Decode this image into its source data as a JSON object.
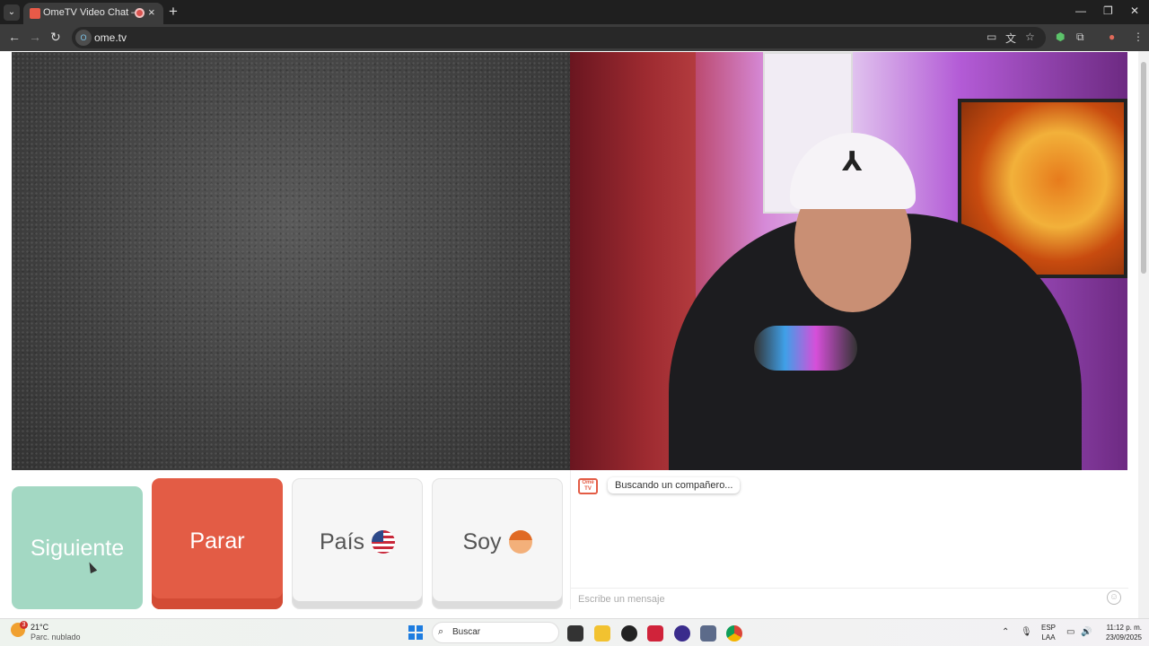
{
  "browser": {
    "tab_title": "OmeTV Video Chat — Omegle",
    "url": "ome.tv",
    "site_icon_text": "O",
    "tab_close": "×",
    "new_tab": "+",
    "icons": [
      "tab-list-icon",
      "back-icon",
      "forward-icon",
      "reload-icon",
      "cast-icon",
      "translate-icon",
      "star-icon",
      "extension-shield-icon",
      "extensions-puzzle-icon",
      "profile-icon",
      "menu-kebab-icon",
      "minimize-icon",
      "restore-icon",
      "close-icon"
    ]
  },
  "controls": {
    "next_label": "Siguiente",
    "stop_label": "Parar",
    "country_label": "País",
    "me_label": "Soy",
    "colors": {
      "next": "#a3d8c3",
      "stop": "#e35c45",
      "neutral": "#f6f6f6"
    }
  },
  "chat": {
    "logo_text": "Ome TV",
    "status_message": "Buscando un compañero...",
    "input_placeholder": "Escribe un mensaje"
  },
  "taskbar": {
    "weather_badge": "3",
    "weather_temp": "21°C",
    "weather_desc": "Parc. nublado",
    "search_placeholder": "Buscar",
    "lang_top": "ESP",
    "lang_bottom": "LAA",
    "time": "11:12 p. m.",
    "date": "23/09/2025"
  }
}
